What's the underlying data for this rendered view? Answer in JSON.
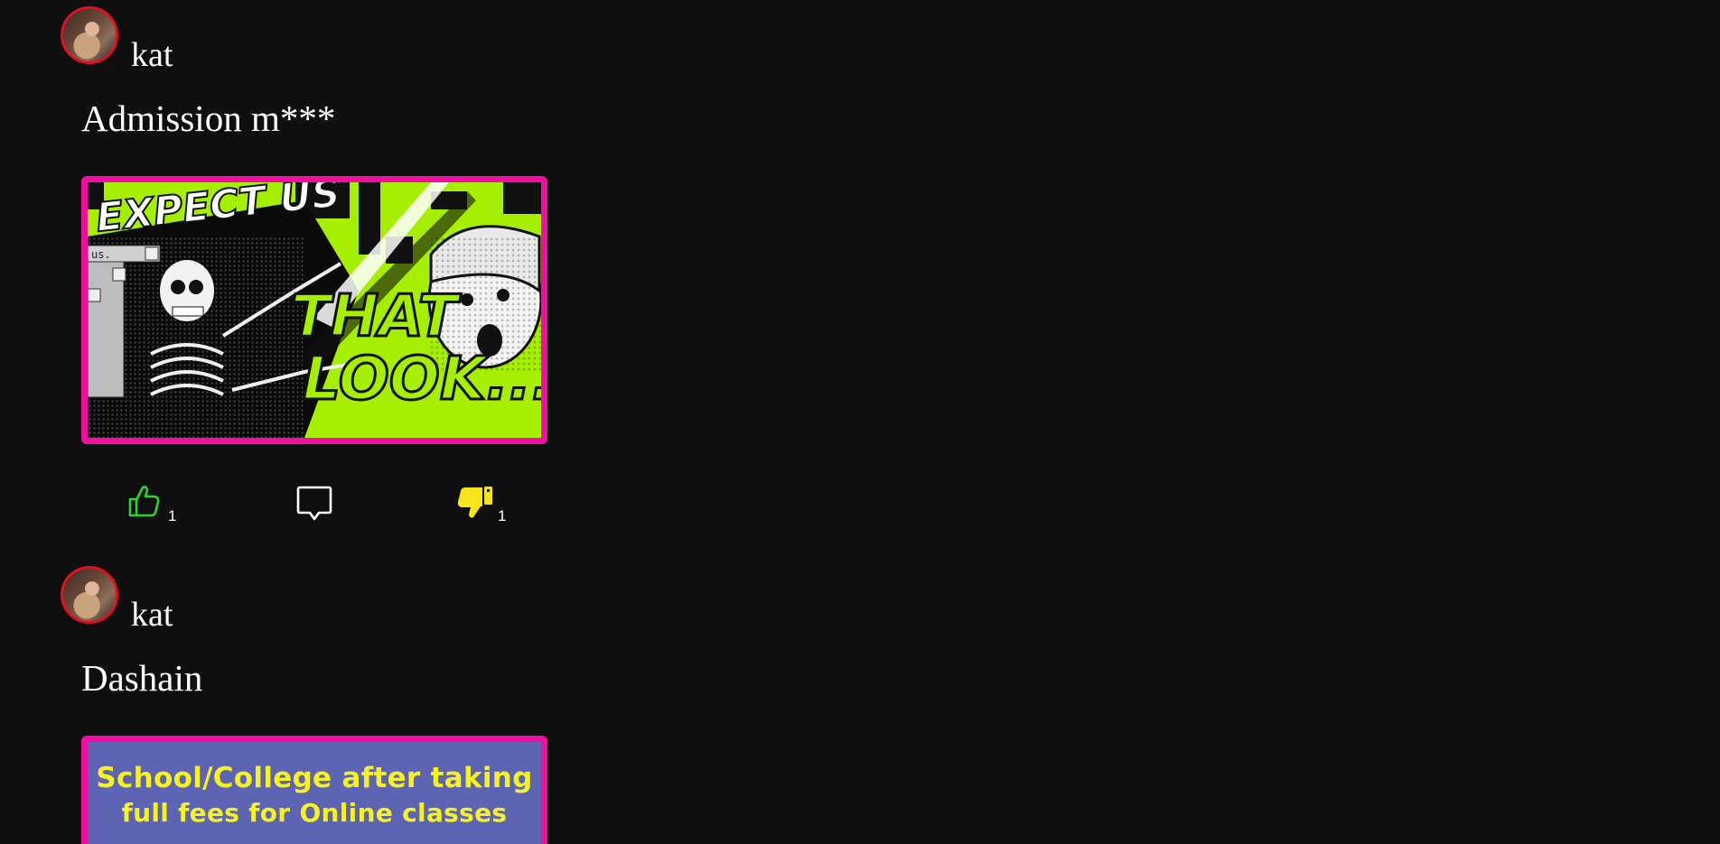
{
  "posts": [
    {
      "username": "kat",
      "caption": "Admission m***",
      "image_texts": [
        "EXPECT US",
        "THAT",
        "LOOK..."
      ],
      "likes": "1",
      "dislikes": "1"
    },
    {
      "username": "kat",
      "caption": "Dashain",
      "image_texts": [
        "School/College after taking",
        "full fees for Online classes"
      ]
    }
  ],
  "colors": {
    "background": "#0f0f10",
    "avatar_ring": "#e01020",
    "media_border": "#f20ea0",
    "like": "#2bd42b",
    "dislike": "#f5e51a",
    "banner_bg": "#5d64b4",
    "banner_text": "#f6f222"
  },
  "icons": {
    "like": "thumbs-up-icon",
    "comment": "comment-bubble-icon",
    "dislike": "thumbs-down-icon"
  }
}
